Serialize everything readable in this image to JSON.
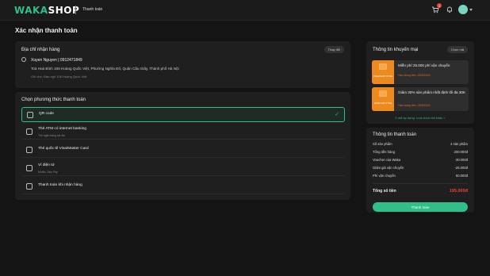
{
  "header": {
    "logo_part1": "WAKA",
    "logo_part2": "SHOP",
    "breadcrumb": "Thanh toán",
    "cart_count": "1"
  },
  "page": {
    "title": "Xác nhận thanh toán"
  },
  "address": {
    "section_title": "Địa chỉ nhận hàng",
    "change_label": "Thay đổi",
    "recipient": "Xuyen Nguyen | 0912471849",
    "line": "Toà Hoà Bình 106 Hoàng Quốc Việt, Phường Nghĩa Đô, Quận Cầu Giấy, Thành phố Hà Nội",
    "note": "Ghi chú: Đầu ngõ 106 Hoàng Quốc Việt"
  },
  "payment": {
    "section_title": "Chọn phương thức thanh toán",
    "options": [
      {
        "label": "QR code",
        "sub": ""
      },
      {
        "label": "Thẻ ATM có internet banking",
        "sub": "Thẻ ngân hàng nội địa"
      },
      {
        "label": "Thẻ quốc tế Visa/Master Card",
        "sub": ""
      },
      {
        "label": "Ví điện tử",
        "sub": "MoMo, Zalo Pay"
      },
      {
        "label": "Thanh toán khi nhận hàng",
        "sub": ""
      }
    ]
  },
  "promo": {
    "section_title": "Thông tin khuyến mại",
    "choose_label": "Chọn mã",
    "vouchers": [
      {
        "tag": "FREESHIP XTRA",
        "title": "Miễn phí 25.000 phí vận chuyển",
        "expiry": "Hạn dùng đến: 25/3/2024"
      },
      {
        "tag": "GIẢM GIÁ XTRA",
        "title": "Giảm 30% sản phẩm nhất định tối đa 30K",
        "expiry": "Hạn dùng đến: 25/3/2024"
      }
    ],
    "more_label": "2 mã áp dụng. Lựa chọn mã khác >"
  },
  "summary": {
    "section_title": "Thông tin thanh toán",
    "rows": [
      {
        "label": "Số sản phẩm",
        "value": "4 sản phẩm"
      },
      {
        "label": "Tổng tiền hàng",
        "value": "200.000đ"
      },
      {
        "label": "Voucher của Waka",
        "value": "-30.000đ"
      },
      {
        "label": "Giảm giá vận chuyển",
        "value": "-25.000đ"
      },
      {
        "label": "Phí vận chuyển",
        "value": "50.000đ"
      }
    ],
    "total_label": "Tổng số tiền",
    "total_value": "195.000đ",
    "pay_button": "Thanh toán"
  },
  "colors": {
    "accent": "#2fbf88",
    "danger": "#e2463c",
    "voucher": "#ed8a1f"
  }
}
